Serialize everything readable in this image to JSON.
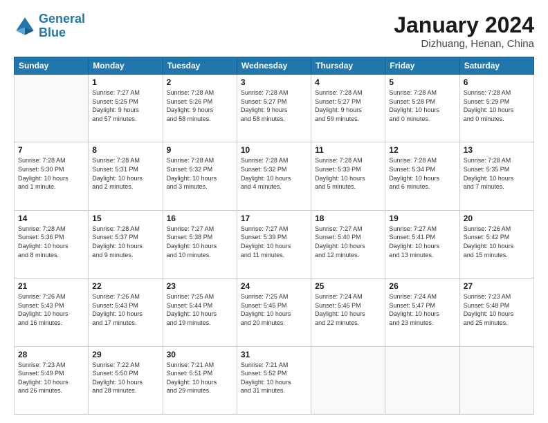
{
  "header": {
    "logo_line1": "General",
    "logo_line2": "Blue",
    "main_title": "January 2024",
    "subtitle": "Dizhuang, Henan, China"
  },
  "weekdays": [
    "Sunday",
    "Monday",
    "Tuesday",
    "Wednesday",
    "Thursday",
    "Friday",
    "Saturday"
  ],
  "weeks": [
    [
      {
        "num": "",
        "info": ""
      },
      {
        "num": "1",
        "info": "Sunrise: 7:27 AM\nSunset: 5:25 PM\nDaylight: 9 hours\nand 57 minutes."
      },
      {
        "num": "2",
        "info": "Sunrise: 7:28 AM\nSunset: 5:26 PM\nDaylight: 9 hours\nand 58 minutes."
      },
      {
        "num": "3",
        "info": "Sunrise: 7:28 AM\nSunset: 5:27 PM\nDaylight: 9 hours\nand 58 minutes."
      },
      {
        "num": "4",
        "info": "Sunrise: 7:28 AM\nSunset: 5:27 PM\nDaylight: 9 hours\nand 59 minutes."
      },
      {
        "num": "5",
        "info": "Sunrise: 7:28 AM\nSunset: 5:28 PM\nDaylight: 10 hours\nand 0 minutes."
      },
      {
        "num": "6",
        "info": "Sunrise: 7:28 AM\nSunset: 5:29 PM\nDaylight: 10 hours\nand 0 minutes."
      }
    ],
    [
      {
        "num": "7",
        "info": "Sunrise: 7:28 AM\nSunset: 5:30 PM\nDaylight: 10 hours\nand 1 minute."
      },
      {
        "num": "8",
        "info": "Sunrise: 7:28 AM\nSunset: 5:31 PM\nDaylight: 10 hours\nand 2 minutes."
      },
      {
        "num": "9",
        "info": "Sunrise: 7:28 AM\nSunset: 5:32 PM\nDaylight: 10 hours\nand 3 minutes."
      },
      {
        "num": "10",
        "info": "Sunrise: 7:28 AM\nSunset: 5:32 PM\nDaylight: 10 hours\nand 4 minutes."
      },
      {
        "num": "11",
        "info": "Sunrise: 7:28 AM\nSunset: 5:33 PM\nDaylight: 10 hours\nand 5 minutes."
      },
      {
        "num": "12",
        "info": "Sunrise: 7:28 AM\nSunset: 5:34 PM\nDaylight: 10 hours\nand 6 minutes."
      },
      {
        "num": "13",
        "info": "Sunrise: 7:28 AM\nSunset: 5:35 PM\nDaylight: 10 hours\nand 7 minutes."
      }
    ],
    [
      {
        "num": "14",
        "info": "Sunrise: 7:28 AM\nSunset: 5:36 PM\nDaylight: 10 hours\nand 8 minutes."
      },
      {
        "num": "15",
        "info": "Sunrise: 7:28 AM\nSunset: 5:37 PM\nDaylight: 10 hours\nand 9 minutes."
      },
      {
        "num": "16",
        "info": "Sunrise: 7:27 AM\nSunset: 5:38 PM\nDaylight: 10 hours\nand 10 minutes."
      },
      {
        "num": "17",
        "info": "Sunrise: 7:27 AM\nSunset: 5:39 PM\nDaylight: 10 hours\nand 11 minutes."
      },
      {
        "num": "18",
        "info": "Sunrise: 7:27 AM\nSunset: 5:40 PM\nDaylight: 10 hours\nand 12 minutes."
      },
      {
        "num": "19",
        "info": "Sunrise: 7:27 AM\nSunset: 5:41 PM\nDaylight: 10 hours\nand 13 minutes."
      },
      {
        "num": "20",
        "info": "Sunrise: 7:26 AM\nSunset: 5:42 PM\nDaylight: 10 hours\nand 15 minutes."
      }
    ],
    [
      {
        "num": "21",
        "info": "Sunrise: 7:26 AM\nSunset: 5:43 PM\nDaylight: 10 hours\nand 16 minutes."
      },
      {
        "num": "22",
        "info": "Sunrise: 7:26 AM\nSunset: 5:43 PM\nDaylight: 10 hours\nand 17 minutes."
      },
      {
        "num": "23",
        "info": "Sunrise: 7:25 AM\nSunset: 5:44 PM\nDaylight: 10 hours\nand 19 minutes."
      },
      {
        "num": "24",
        "info": "Sunrise: 7:25 AM\nSunset: 5:45 PM\nDaylight: 10 hours\nand 20 minutes."
      },
      {
        "num": "25",
        "info": "Sunrise: 7:24 AM\nSunset: 5:46 PM\nDaylight: 10 hours\nand 22 minutes."
      },
      {
        "num": "26",
        "info": "Sunrise: 7:24 AM\nSunset: 5:47 PM\nDaylight: 10 hours\nand 23 minutes."
      },
      {
        "num": "27",
        "info": "Sunrise: 7:23 AM\nSunset: 5:48 PM\nDaylight: 10 hours\nand 25 minutes."
      }
    ],
    [
      {
        "num": "28",
        "info": "Sunrise: 7:23 AM\nSunset: 5:49 PM\nDaylight: 10 hours\nand 26 minutes."
      },
      {
        "num": "29",
        "info": "Sunrise: 7:22 AM\nSunset: 5:50 PM\nDaylight: 10 hours\nand 28 minutes."
      },
      {
        "num": "30",
        "info": "Sunrise: 7:21 AM\nSunset: 5:51 PM\nDaylight: 10 hours\nand 29 minutes."
      },
      {
        "num": "31",
        "info": "Sunrise: 7:21 AM\nSunset: 5:52 PM\nDaylight: 10 hours\nand 31 minutes."
      },
      {
        "num": "",
        "info": ""
      },
      {
        "num": "",
        "info": ""
      },
      {
        "num": "",
        "info": ""
      }
    ]
  ]
}
